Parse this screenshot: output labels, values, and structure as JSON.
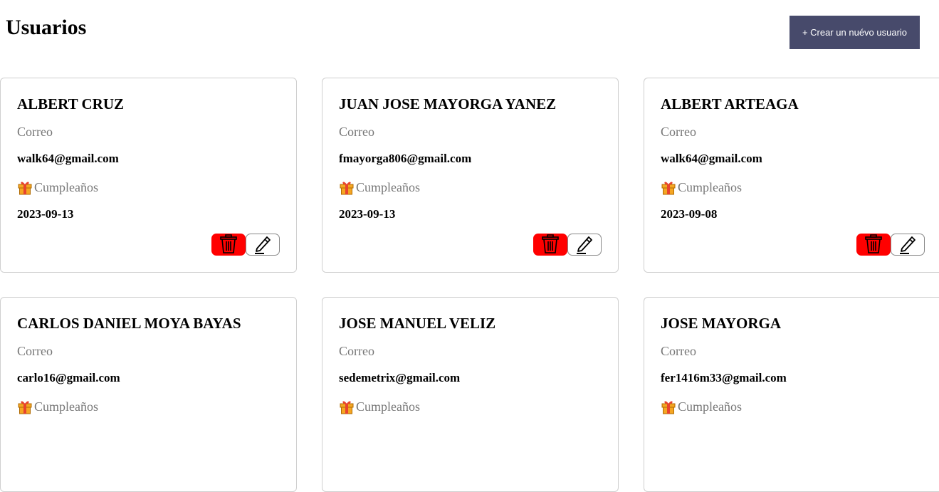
{
  "header": {
    "title": "Usuarios",
    "create_label": "+ Crear un nuévo usuario"
  },
  "labels": {
    "email_label": "Correo",
    "birthday_label": "Cumpleaños"
  },
  "users": [
    {
      "name": "ALBERT CRUZ",
      "email": "walk64@gmail.com",
      "birthday": "2023-09-13"
    },
    {
      "name": "JUAN JOSE MAYORGA YANEZ",
      "email": "fmayorga806@gmail.com",
      "birthday": "2023-09-13"
    },
    {
      "name": "ALBERT ARTEAGA",
      "email": "walk64@gmail.com",
      "birthday": "2023-09-08"
    },
    {
      "name": "CARLOS DANIEL MOYA BAYAS",
      "email": "carlo16@gmail.com",
      "birthday": ""
    },
    {
      "name": "JOSE MANUEL VELIZ",
      "email": "sedemetrix@gmail.com",
      "birthday": ""
    },
    {
      "name": "JOSE MAYORGA",
      "email": "fer1416m33@gmail.com",
      "birthday": ""
    }
  ],
  "icons": {
    "gift": "gift-icon",
    "delete": "trash-icon",
    "edit": "pencil-icon"
  },
  "colors": {
    "create_button": "#474a6b",
    "delete_button": "#ff0000",
    "muted_text": "#777777",
    "gift_orange": "#f5a623",
    "gift_red": "#e8432e"
  }
}
